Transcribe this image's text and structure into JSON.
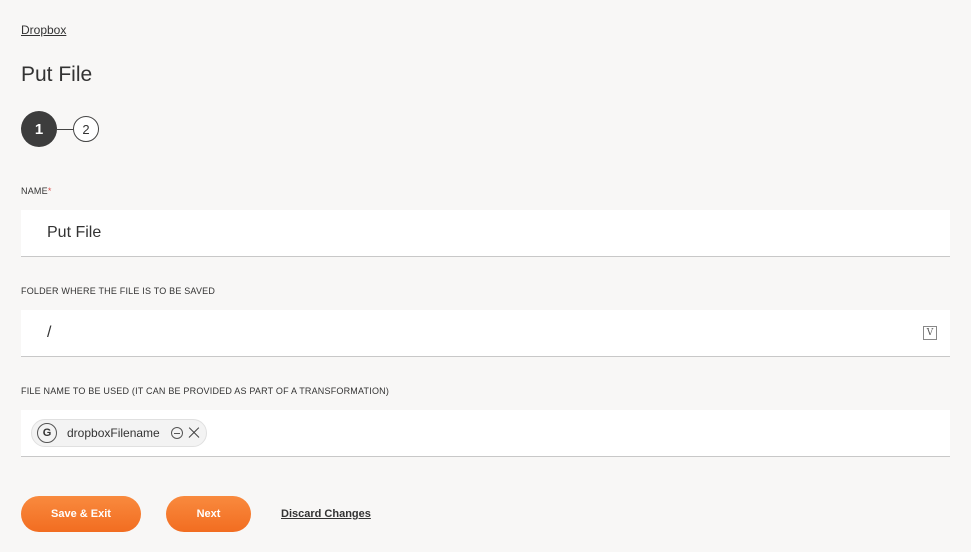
{
  "breadcrumb": {
    "label": "Dropbox"
  },
  "page": {
    "title": "Put File"
  },
  "stepper": {
    "step1": "1",
    "step2": "2"
  },
  "fields": {
    "name": {
      "label": "NAME",
      "required_mark": "*",
      "value": "Put File"
    },
    "folder": {
      "label": "FOLDER WHERE THE FILE IS TO BE SAVED",
      "value": "/",
      "variable_icon_glyph": "V"
    },
    "filename": {
      "label": "FILE NAME TO BE USED (IT CAN BE PROVIDED AS PART OF A TRANSFORMATION)",
      "pill": {
        "badge": "G",
        "text": "dropboxFilename"
      }
    }
  },
  "actions": {
    "save_exit": "Save & Exit",
    "next": "Next",
    "discard": "Discard Changes"
  },
  "colors": {
    "accent": "#f57c2e",
    "background": "#f8f7f6",
    "required": "#d9534f"
  }
}
